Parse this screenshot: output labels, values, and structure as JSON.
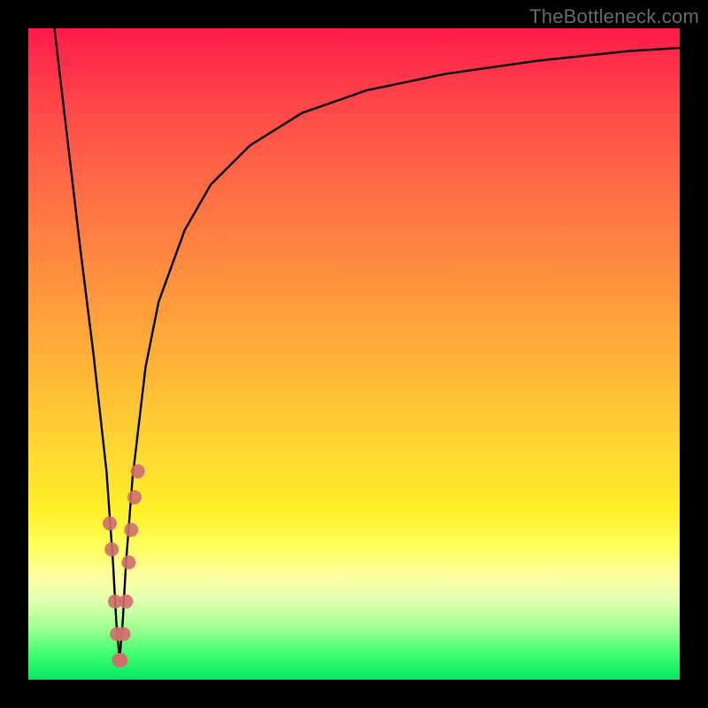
{
  "watermark": "TheBottleneck.com",
  "colors": {
    "frame": "#000000",
    "curve": "#000000",
    "markers": "#cf6e6e",
    "gradient_top": "#ff1a4a",
    "gradient_bottom": "#00e860"
  },
  "chart_data": {
    "type": "line",
    "title": "",
    "xlabel": "",
    "ylabel": "",
    "xlim": [
      0,
      100
    ],
    "ylim": [
      0,
      100
    ],
    "series": [
      {
        "name": "bottleneck-curve",
        "x": [
          4,
          6,
          8,
          10,
          12,
          13,
          13.5,
          14,
          14.5,
          15,
          16,
          18,
          20,
          24,
          28,
          34,
          42,
          52,
          64,
          78,
          92,
          100
        ],
        "y": [
          100,
          83,
          66,
          50,
          32,
          18,
          9,
          3,
          9,
          18,
          31,
          48,
          58,
          69,
          76,
          82,
          87,
          90.5,
          93,
          95,
          96.5,
          97
        ]
      }
    ],
    "markers": {
      "name": "highlight-points",
      "x": [
        12.5,
        12.8,
        13.3,
        13.6,
        13.9,
        14.2,
        14.6,
        15.0,
        15.4,
        15.8,
        16.3,
        16.8
      ],
      "y": [
        24,
        20,
        12,
        7,
        3,
        3,
        7,
        12,
        18,
        23,
        28,
        32
      ]
    }
  }
}
